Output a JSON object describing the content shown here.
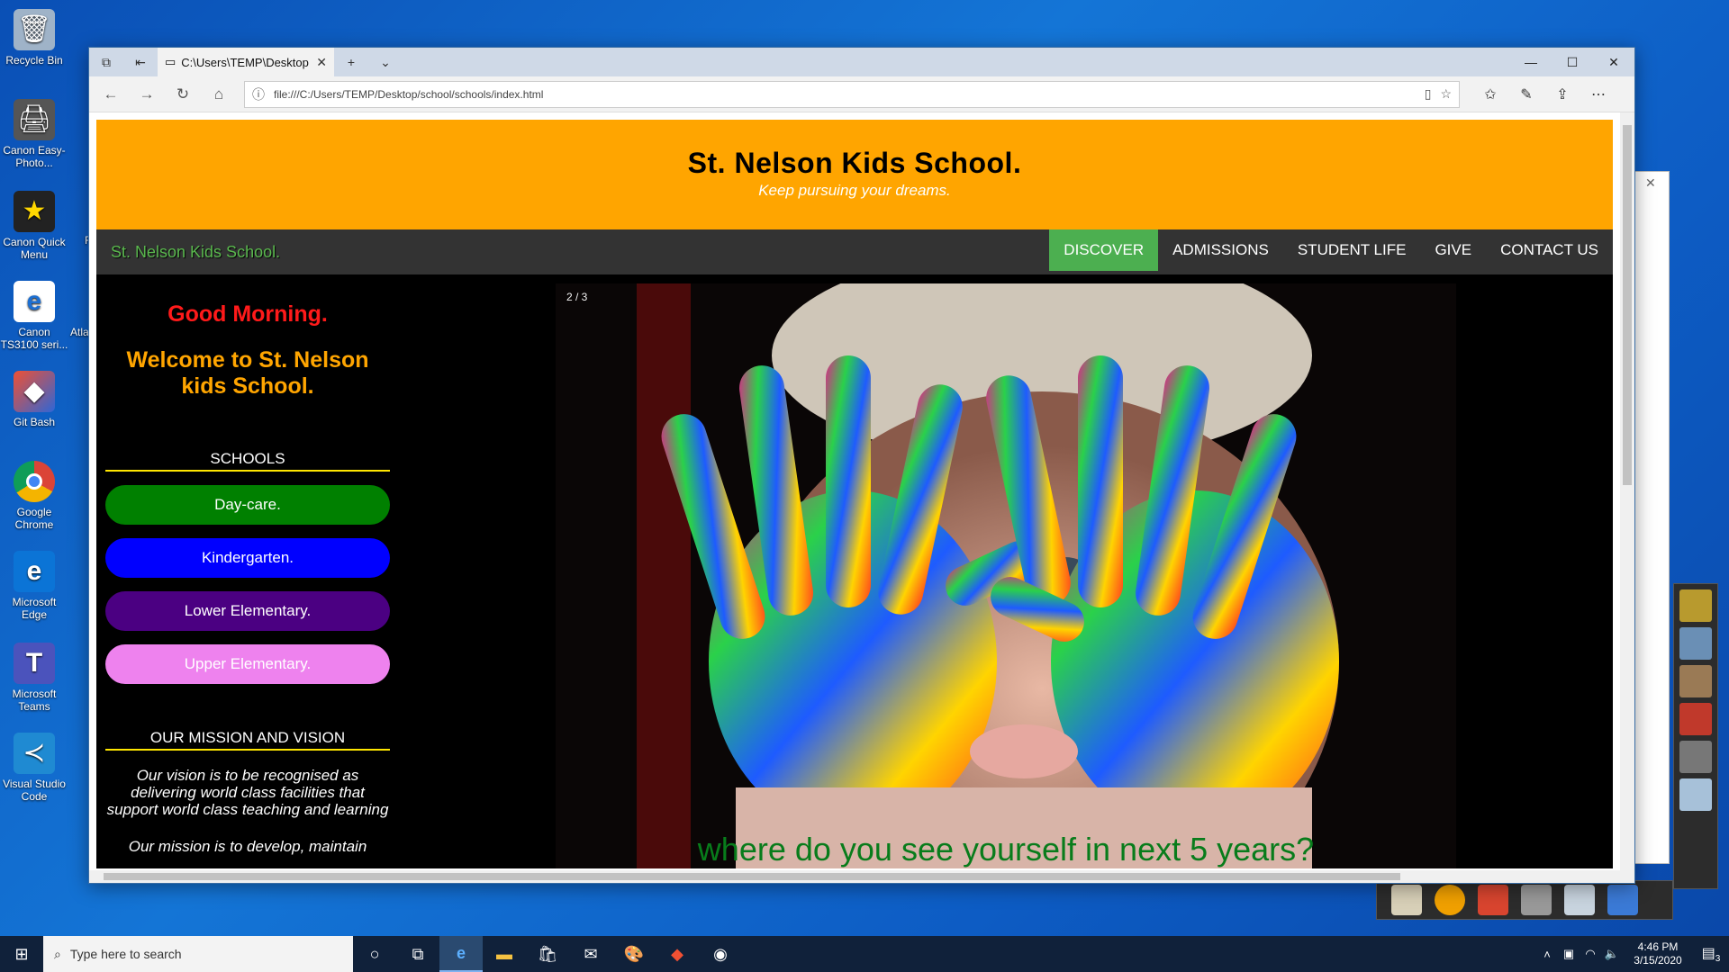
{
  "desktop": {
    "icons": [
      {
        "label": "Recycle Bin",
        "icon": "recycle-bin-icon",
        "color": "#cfd8e3"
      },
      {
        "label": "Canon Easy-Photo...",
        "icon": "canon-printer-icon",
        "color": "#5c5c5c"
      },
      {
        "label": "Canon Quick Menu",
        "icon": "canon-quick-menu-icon",
        "color": "#1d1d1d"
      },
      {
        "label": "Canon TS3100 seri...",
        "icon": "edge-legacy-icon",
        "color": "#ffffff"
      },
      {
        "label": "Git Bash",
        "icon": "git-bash-icon",
        "color": "#2f66d6"
      },
      {
        "label": "Google Chrome",
        "icon": "chrome-icon",
        "color": "#ffffff"
      },
      {
        "label": "Microsoft Edge",
        "icon": "edge-icon",
        "color": "#0b74d6"
      },
      {
        "label": "Microsoft Teams",
        "icon": "teams-icon",
        "color": "#4b53bc"
      },
      {
        "label": "Visual Studio Code",
        "icon": "vscode-icon",
        "color": "#1f8ad2"
      }
    ],
    "stray_labels": [
      "Atla",
      "F"
    ]
  },
  "browser": {
    "tab_title": "C:\\Users\\TEMP\\Desktop",
    "url": "file:///C:/Users/TEMP/Desktop/school/schools/index.html"
  },
  "site": {
    "title": "St. Nelson Kids School.",
    "tagline": "Keep pursuing your dreams.",
    "brand": "St. Nelson Kids School.",
    "nav": [
      {
        "label": "DISCOVER",
        "active": true
      },
      {
        "label": "ADMISSIONS"
      },
      {
        "label": "STUDENT LIFE"
      },
      {
        "label": "GIVE"
      },
      {
        "label": "CONTACT US"
      }
    ],
    "greeting": "Good Morning.",
    "welcome": "Welcome to St. Nelson kids School.",
    "schools_title": "SCHOOLS",
    "schools": [
      {
        "label": "Day-care.",
        "color": "#008000"
      },
      {
        "label": "Kindergarten.",
        "color": "#0000ff"
      },
      {
        "label": "Lower Elementary.",
        "color": "#4b0082"
      },
      {
        "label": "Upper Elementary.",
        "color": "#ee82ee"
      }
    ],
    "mission_title": "OUR MISSION AND VISION",
    "vision_text": "Our vision is to be recognised as delivering world class facilities that support world class teaching and learning",
    "mission_text": "Our mission is to develop, maintain",
    "slide_counter": "2 / 3",
    "slide_caption": "where do you see yourself in next 5 years?"
  },
  "taskbar": {
    "search_placeholder": "Type here to search",
    "time": "4:46 PM",
    "date": "3/15/2020",
    "notification_count": "3"
  },
  "colors": {
    "header": "#ffa500",
    "nav_active": "#4caf50",
    "caption": "#087c1b"
  }
}
